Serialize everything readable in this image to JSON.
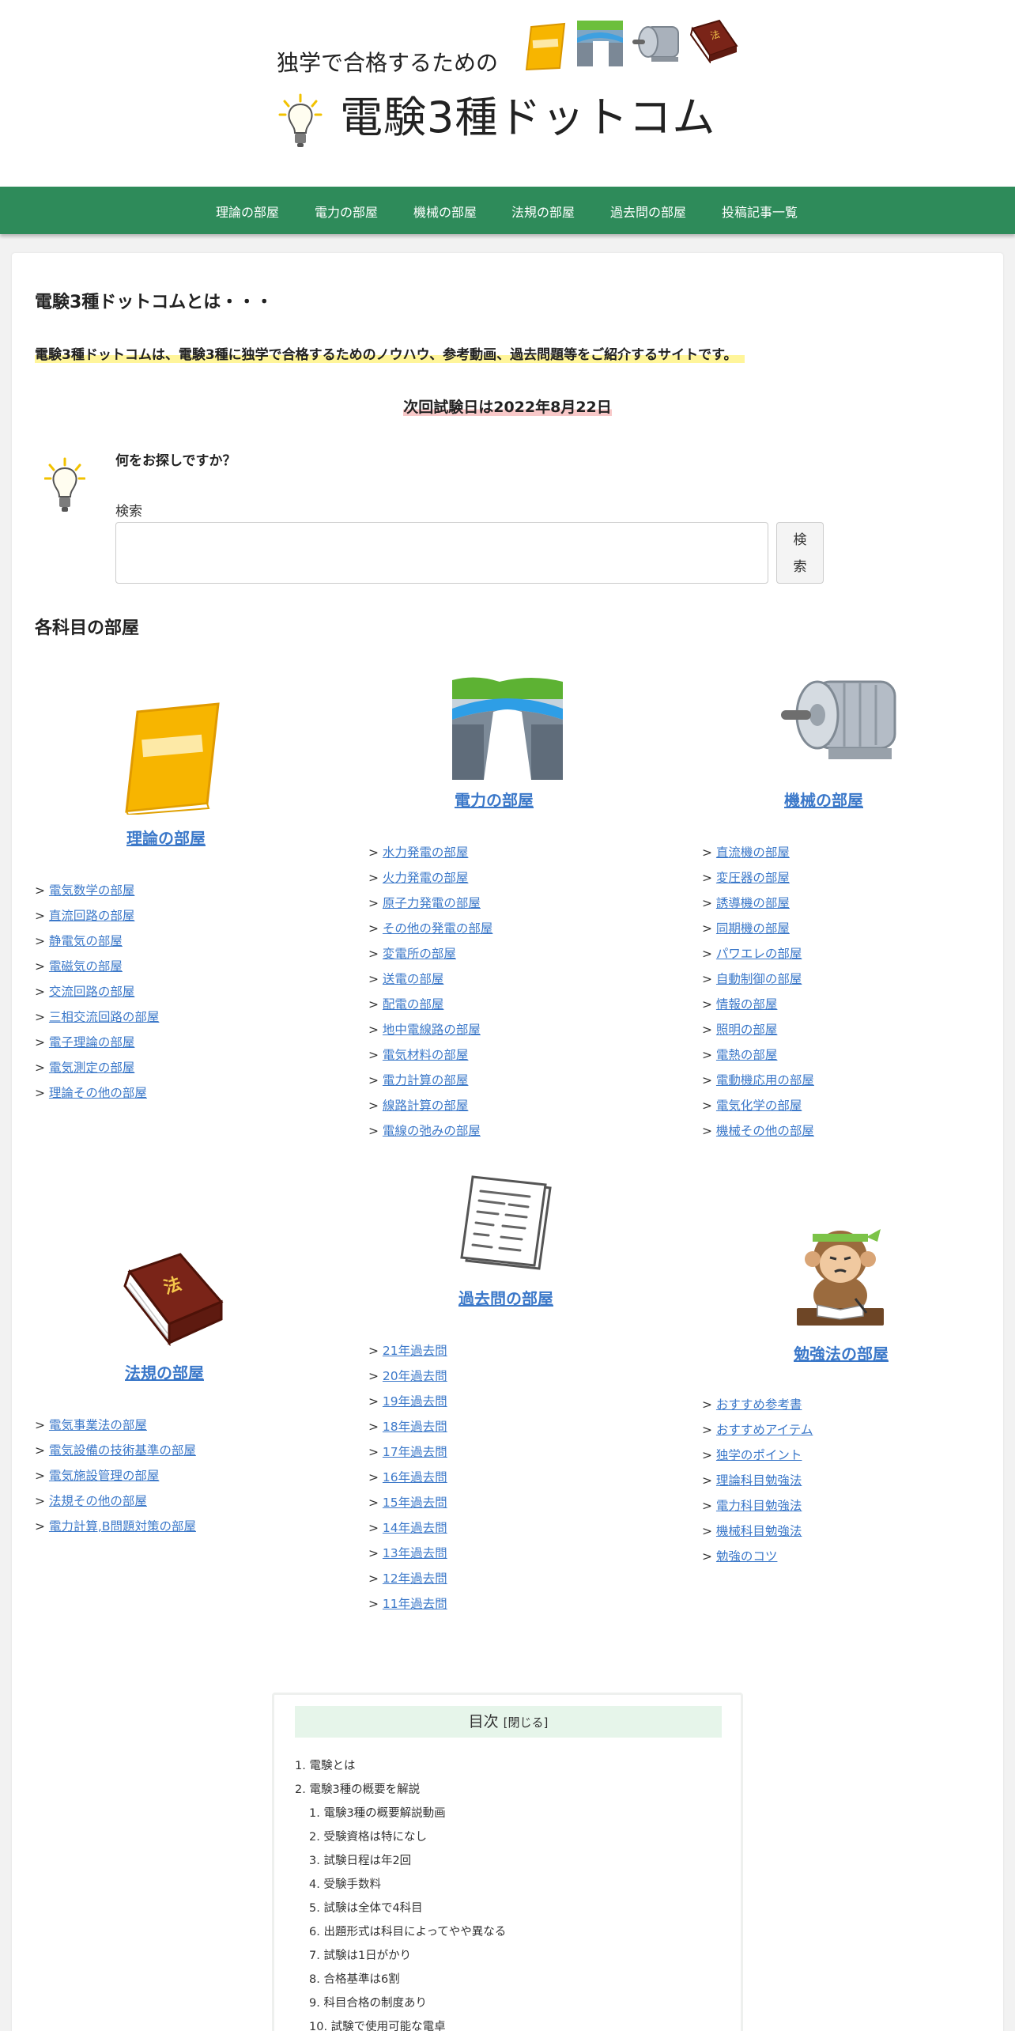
{
  "header": {
    "tagline": "独学で合格するための",
    "site_title": "電験3種ドットコム"
  },
  "nav": {
    "items": [
      "理論の部屋",
      "電力の部屋",
      "機械の部屋",
      "法規の部屋",
      "過去問の部屋",
      "投稿記事一覧"
    ]
  },
  "main": {
    "heading": "電験3種ドットコムとは・・・",
    "intro": "電験3種ドットコムは、電験3種に独学で合格するためのノウハウ、参考動画、過去問題等をご紹介するサイトです。",
    "exam_date": "次回試験日は2022年8月22日"
  },
  "search": {
    "question": "何をお探しですか？",
    "label": "検索",
    "value": "",
    "button_line1": "検",
    "button_line2": "索"
  },
  "rooms_heading": "各科目の部屋",
  "rooms": {
    "riron": {
      "title": "理論の部屋",
      "links": [
        "電気数学の部屋",
        "直流回路の部屋",
        "静電気の部屋",
        "電磁気の部屋",
        "交流回路の部屋",
        "三相交流回路の部屋",
        "電子理論の部屋",
        "電気測定の部屋",
        "理論その他の部屋"
      ]
    },
    "denryoku": {
      "title": "電力の部屋",
      "links": [
        "水力発電の部屋",
        "火力発電の部屋",
        "原子力発電の部屋",
        "その他の発電の部屋",
        "変電所の部屋",
        "送電の部屋",
        "配電の部屋",
        "地中電線路の部屋",
        "電気材料の部屋",
        "電力計算の部屋",
        "線路計算の部屋",
        "電線の弛みの部屋"
      ]
    },
    "kikai": {
      "title": "機械の部屋",
      "links": [
        "直流機の部屋",
        "変圧器の部屋",
        "誘導機の部屋",
        "同期機の部屋",
        "パワエレの部屋",
        "自動制御の部屋",
        "情報の部屋",
        "照明の部屋",
        "電熱の部屋",
        "電動機応用の部屋",
        "電気化学の部屋",
        "機械その他の部屋"
      ]
    },
    "hoki": {
      "title": "法規の部屋",
      "links": [
        "電気事業法の部屋",
        "電気設備の技術基準の部屋",
        "電気施設管理の部屋",
        "法規その他の部屋",
        "電力計算,B問題対策の部屋"
      ]
    },
    "kakomon": {
      "title": "過去問の部屋",
      "links": [
        "21年過去問",
        "20年過去問",
        "19年過去問",
        "18年過去問",
        "17年過去問",
        "16年過去問",
        "15年過去問",
        "14年過去問",
        "13年過去問",
        "12年過去問",
        "11年過去問"
      ]
    },
    "benkyo": {
      "title": "勉強法の部屋",
      "links": [
        "おすすめ参考書",
        "おすすめアイテム",
        "独学のポイント",
        "理論科目勉強法",
        "電力科目勉強法",
        "機械科目勉強法",
        "勉強のコツ"
      ]
    }
  },
  "link_prefix": "> ",
  "toc": {
    "title": "目次",
    "toggle": "[閉じる]",
    "items": [
      {
        "num": "1.",
        "text": "電験とは"
      },
      {
        "num": "2.",
        "text": "電験3種の概要を解説"
      }
    ],
    "subitems": [
      {
        "num": "1.",
        "text": "電験3種の概要解説動画"
      },
      {
        "num": "2.",
        "text": "受験資格は特になし"
      },
      {
        "num": "3.",
        "text": "試験日程は年2回"
      },
      {
        "num": "4.",
        "text": "受験手数料"
      },
      {
        "num": "5.",
        "text": "試験は全体で4科目"
      },
      {
        "num": "6.",
        "text": "出題形式は科目によってやや異なる"
      },
      {
        "num": "7.",
        "text": "試験は1日がかり"
      },
      {
        "num": "8.",
        "text": "合格基準は6割"
      },
      {
        "num": "9.",
        "text": "科目合格の制度あり"
      },
      {
        "num": "10.",
        "text": "試験で使用可能な電卓"
      }
    ]
  },
  "colors": {
    "nav_bg": "#2e8b5a",
    "link": "#3b78c9",
    "marker_yellow": "#fff59a",
    "marker_red": "#f8c8c8",
    "toc_head_bg": "#e6f5ea"
  },
  "icons": [
    "lightbulb-icon",
    "book-icon",
    "dam-icon",
    "motor-icon",
    "law-book-icon",
    "papers-icon",
    "monkey-study-icon"
  ]
}
